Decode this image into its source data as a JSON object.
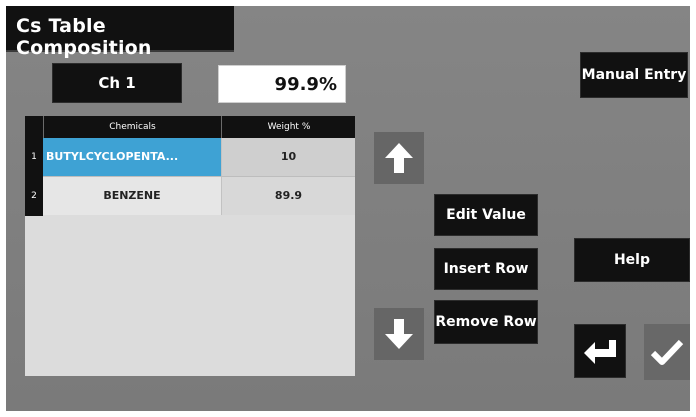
{
  "title": "Cs Table Composition",
  "channel_label": "Ch 1",
  "total_percent": "99.9%",
  "manual_entry_label": "Manual Entry",
  "table": {
    "columns": [
      "Chemicals",
      "Weight %"
    ],
    "rows": [
      {
        "index": "1",
        "chemical": "BUTYLCYCLOPENTA...",
        "weight": "10",
        "selected": true
      },
      {
        "index": "2",
        "chemical": "BENZENE",
        "weight": "89.9",
        "selected": false
      }
    ]
  },
  "buttons": {
    "edit_value": "Edit Value",
    "insert_row": "Insert Row",
    "remove_row": "Remove Row",
    "help": "Help"
  },
  "icons": {
    "up": "arrow-up-icon",
    "down": "arrow-down-icon",
    "enter": "enter-return-icon",
    "confirm": "checkmark-icon"
  },
  "colors": {
    "selected_cell": "#3ea2d4",
    "background": "#808080",
    "button": "#111111"
  }
}
